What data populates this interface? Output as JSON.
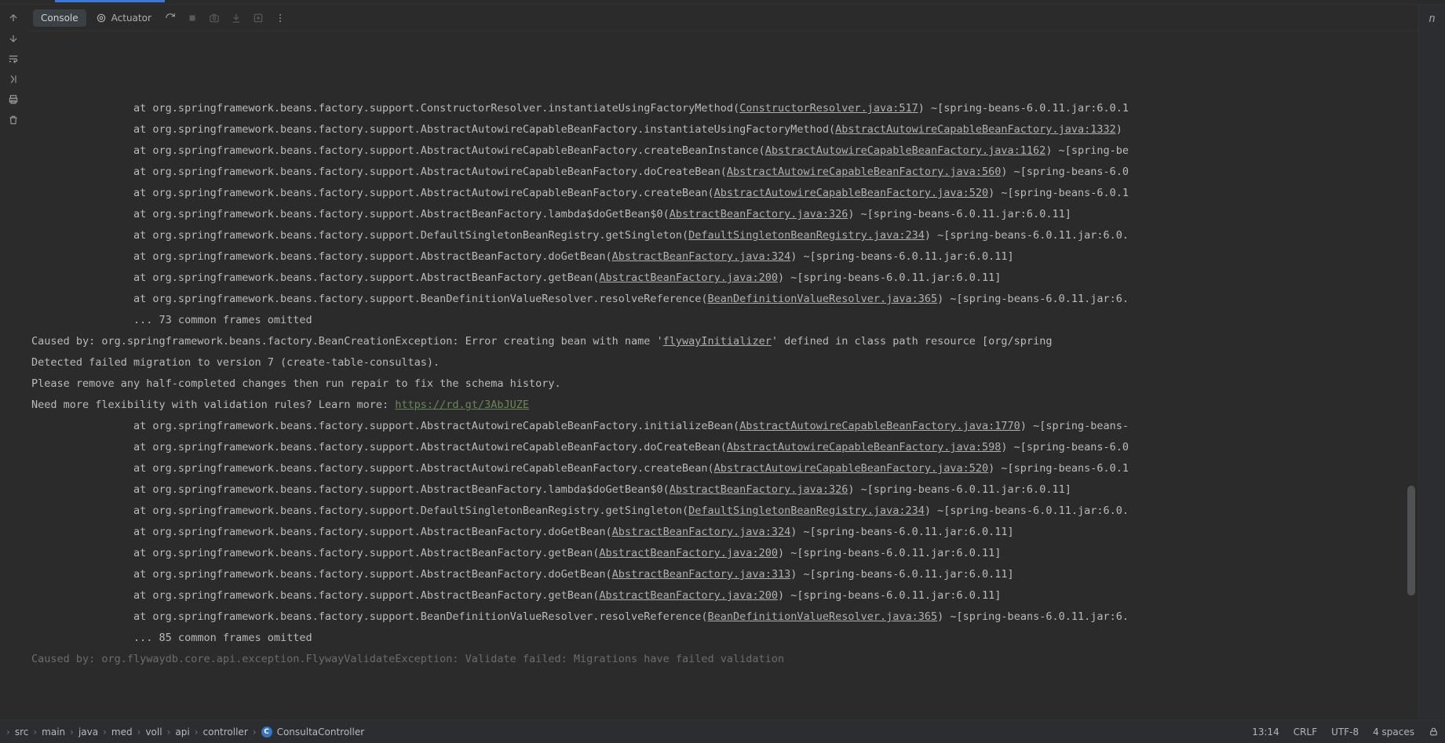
{
  "tabs": {
    "console": "Console",
    "actuator": "Actuator"
  },
  "lines": [
    {
      "indent": 4,
      "pre": "at org.springframework.beans.factory.support.ConstructorResolver.instantiateUsingFactoryMethod(",
      "link": "ConstructorResolver.java:517",
      "post": ") ~[spring-beans-6.0.11.jar:6.0.1"
    },
    {
      "indent": 4,
      "pre": "at org.springframework.beans.factory.support.AbstractAutowireCapableBeanFactory.instantiateUsingFactoryMethod(",
      "link": "AbstractAutowireCapableBeanFactory.java:1332",
      "post": ")"
    },
    {
      "indent": 4,
      "pre": "at org.springframework.beans.factory.support.AbstractAutowireCapableBeanFactory.createBeanInstance(",
      "link": "AbstractAutowireCapableBeanFactory.java:1162",
      "post": ") ~[spring-be"
    },
    {
      "indent": 4,
      "pre": "at org.springframework.beans.factory.support.AbstractAutowireCapableBeanFactory.doCreateBean(",
      "link": "AbstractAutowireCapableBeanFactory.java:560",
      "post": ") ~[spring-beans-6.0"
    },
    {
      "indent": 4,
      "pre": "at org.springframework.beans.factory.support.AbstractAutowireCapableBeanFactory.createBean(",
      "link": "AbstractAutowireCapableBeanFactory.java:520",
      "post": ") ~[spring-beans-6.0.1"
    },
    {
      "indent": 4,
      "pre": "at org.springframework.beans.factory.support.AbstractBeanFactory.lambda$doGetBean$0(",
      "link": "AbstractBeanFactory.java:326",
      "post": ") ~[spring-beans-6.0.11.jar:6.0.11]"
    },
    {
      "indent": 4,
      "pre": "at org.springframework.beans.factory.support.DefaultSingletonBeanRegistry.getSingleton(",
      "link": "DefaultSingletonBeanRegistry.java:234",
      "post": ") ~[spring-beans-6.0.11.jar:6.0."
    },
    {
      "indent": 4,
      "pre": "at org.springframework.beans.factory.support.AbstractBeanFactory.doGetBean(",
      "link": "AbstractBeanFactory.java:324",
      "post": ") ~[spring-beans-6.0.11.jar:6.0.11]"
    },
    {
      "indent": 4,
      "pre": "at org.springframework.beans.factory.support.AbstractBeanFactory.getBean(",
      "link": "AbstractBeanFactory.java:200",
      "post": ") ~[spring-beans-6.0.11.jar:6.0.11]"
    },
    {
      "indent": 4,
      "pre": "at org.springframework.beans.factory.support.BeanDefinitionValueResolver.resolveReference(",
      "link": "BeanDefinitionValueResolver.java:365",
      "post": ") ~[spring-beans-6.0.11.jar:6."
    },
    {
      "indent": 4,
      "pre": "... 73 common frames omitted",
      "link": "",
      "post": ""
    },
    {
      "indent": 0,
      "pre": "Caused by: org.springframework.beans.factory.BeanCreationException: Error creating bean with name '",
      "link": "flywayInitializer",
      "post": "' defined in class path resource [org/spring"
    },
    {
      "indent": 0,
      "pre": "Detected failed migration to version 7 (create-table-consultas).",
      "link": "",
      "post": ""
    },
    {
      "indent": 0,
      "pre": "Please remove any half-completed changes then run repair to fix the schema history.",
      "link": "",
      "post": ""
    },
    {
      "indent": 0,
      "pre": "Need more flexibility with validation rules? Learn more: ",
      "link": "https://rd.gt/3AbJUZE",
      "post": "",
      "green": true
    },
    {
      "indent": 4,
      "pre": "at org.springframework.beans.factory.support.AbstractAutowireCapableBeanFactory.initializeBean(",
      "link": "AbstractAutowireCapableBeanFactory.java:1770",
      "post": ") ~[spring-beans-"
    },
    {
      "indent": 4,
      "pre": "at org.springframework.beans.factory.support.AbstractAutowireCapableBeanFactory.doCreateBean(",
      "link": "AbstractAutowireCapableBeanFactory.java:598",
      "post": ") ~[spring-beans-6.0"
    },
    {
      "indent": 4,
      "pre": "at org.springframework.beans.factory.support.AbstractAutowireCapableBeanFactory.createBean(",
      "link": "AbstractAutowireCapableBeanFactory.java:520",
      "post": ") ~[spring-beans-6.0.1"
    },
    {
      "indent": 4,
      "pre": "at org.springframework.beans.factory.support.AbstractBeanFactory.lambda$doGetBean$0(",
      "link": "AbstractBeanFactory.java:326",
      "post": ") ~[spring-beans-6.0.11.jar:6.0.11]"
    },
    {
      "indent": 4,
      "pre": "at org.springframework.beans.factory.support.DefaultSingletonBeanRegistry.getSingleton(",
      "link": "DefaultSingletonBeanRegistry.java:234",
      "post": ") ~[spring-beans-6.0.11.jar:6.0."
    },
    {
      "indent": 4,
      "pre": "at org.springframework.beans.factory.support.AbstractBeanFactory.doGetBean(",
      "link": "AbstractBeanFactory.java:324",
      "post": ") ~[spring-beans-6.0.11.jar:6.0.11]"
    },
    {
      "indent": 4,
      "pre": "at org.springframework.beans.factory.support.AbstractBeanFactory.getBean(",
      "link": "AbstractBeanFactory.java:200",
      "post": ") ~[spring-beans-6.0.11.jar:6.0.11]"
    },
    {
      "indent": 4,
      "pre": "at org.springframework.beans.factory.support.AbstractBeanFactory.doGetBean(",
      "link": "AbstractBeanFactory.java:313",
      "post": ") ~[spring-beans-6.0.11.jar:6.0.11]"
    },
    {
      "indent": 4,
      "pre": "at org.springframework.beans.factory.support.AbstractBeanFactory.getBean(",
      "link": "AbstractBeanFactory.java:200",
      "post": ") ~[spring-beans-6.0.11.jar:6.0.11]"
    },
    {
      "indent": 4,
      "pre": "at org.springframework.beans.factory.support.BeanDefinitionValueResolver.resolveReference(",
      "link": "BeanDefinitionValueResolver.java:365",
      "post": ") ~[spring-beans-6.0.11.jar:6."
    },
    {
      "indent": 4,
      "pre": "... 85 common frames omitted",
      "link": "",
      "post": ""
    },
    {
      "indent": 0,
      "pre": "Caused by: org.flywaydb.core.api.exception.FlywayValidateException: Validate failed: Migrations have failed validation",
      "link": "",
      "post": "",
      "faded": true
    }
  ],
  "breadcrumb": [
    "src",
    "main",
    "java",
    "med",
    "voll",
    "api",
    "controller",
    "ConsultaController"
  ],
  "status": {
    "time": "13:14",
    "lineend": "CRLF",
    "encoding": "UTF-8",
    "indent": "4 spaces"
  }
}
